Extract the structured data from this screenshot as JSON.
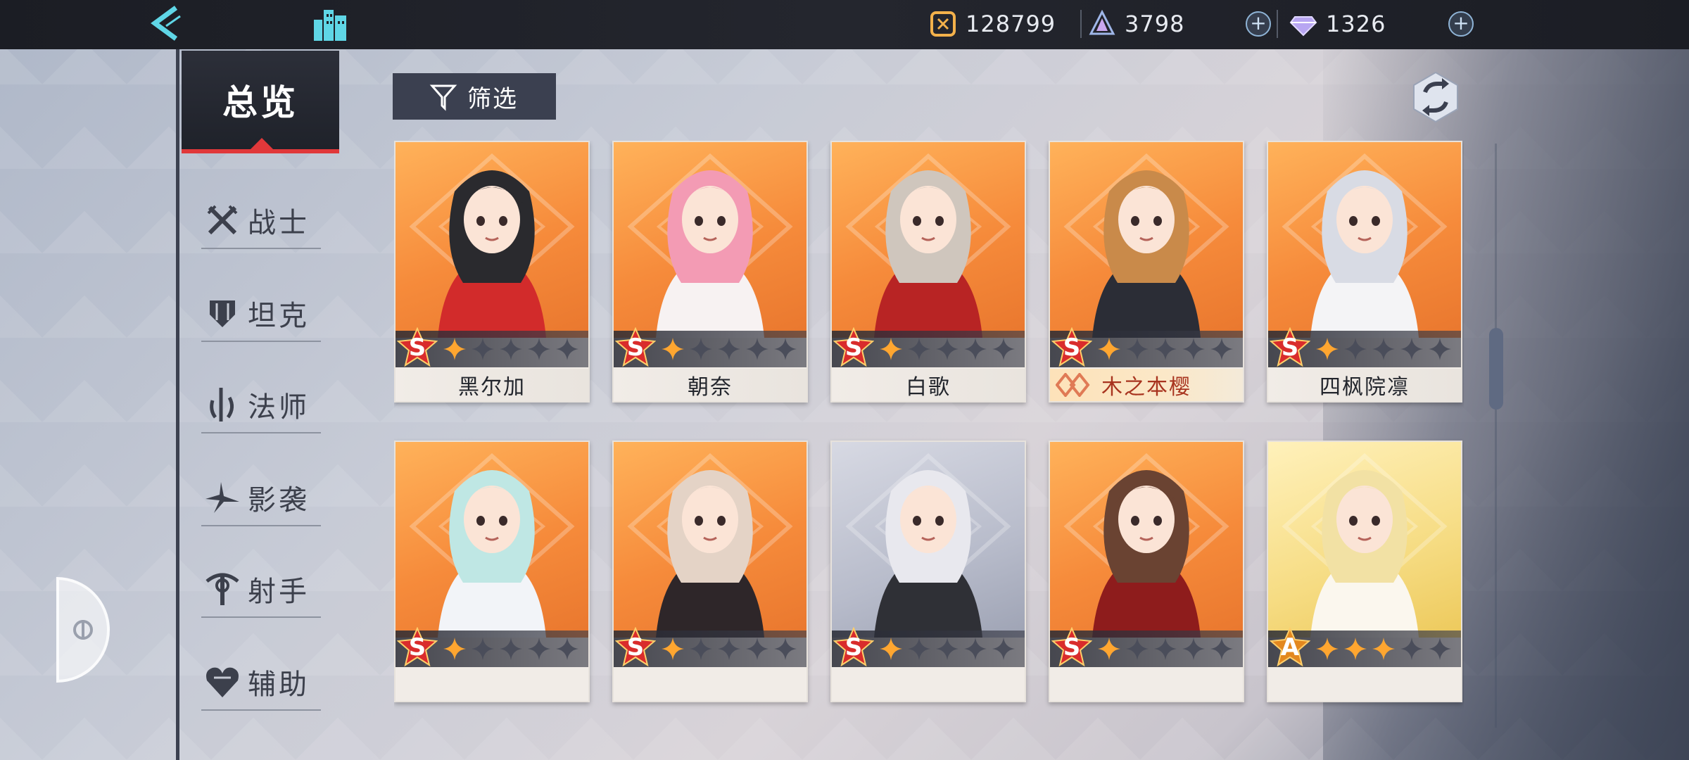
{
  "resources": {
    "gold": "128799",
    "crystal": "3798",
    "gem": "1326"
  },
  "sidebar": {
    "overview_label": "总览",
    "categories": [
      {
        "label": "战士",
        "icon": "swords-icon"
      },
      {
        "label": "坦克",
        "icon": "shield-icon"
      },
      {
        "label": "法师",
        "icon": "staff-icon"
      },
      {
        "label": "影袭",
        "icon": "shuriken-icon"
      },
      {
        "label": "射手",
        "icon": "bow-icon"
      },
      {
        "label": "辅助",
        "icon": "heart-icon"
      }
    ]
  },
  "toolbar": {
    "filter_label": "筛选"
  },
  "characters": [
    {
      "name": "黑尔加",
      "grade": "S",
      "stars": 1,
      "highlight": false
    },
    {
      "name": "朝奈",
      "grade": "S",
      "stars": 1,
      "highlight": false
    },
    {
      "name": "白歌",
      "grade": "S",
      "stars": 1,
      "highlight": false
    },
    {
      "name": "木之本樱",
      "grade": "S",
      "stars": 1,
      "highlight": true
    },
    {
      "name": "四枫院凛",
      "grade": "S",
      "stars": 1,
      "highlight": false
    },
    {
      "name": "",
      "grade": "S",
      "stars": 1,
      "highlight": false
    },
    {
      "name": "",
      "grade": "S",
      "stars": 1,
      "highlight": false
    },
    {
      "name": "",
      "grade": "S",
      "stars": 1,
      "highlight": false
    },
    {
      "name": "",
      "grade": "S",
      "stars": 1,
      "highlight": false
    },
    {
      "name": "",
      "grade": "A",
      "stars": 3,
      "highlight": false
    }
  ],
  "colors": {
    "accent_red": "#e0383a",
    "card_orange": "#f68b3b",
    "star_gold": "#ffa630"
  }
}
